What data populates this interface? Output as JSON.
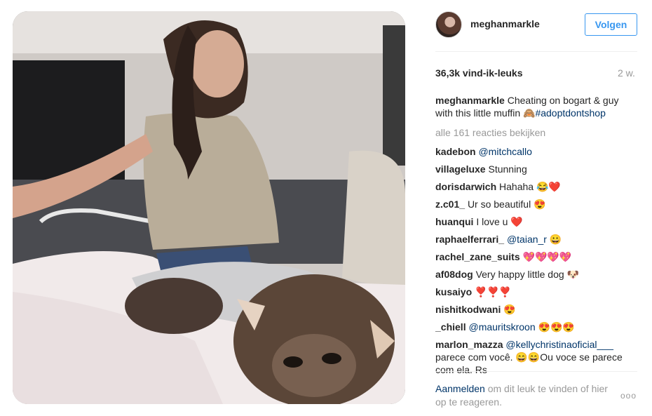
{
  "post": {
    "username": "meghanmarkle",
    "follow_label": "Volgen",
    "likes": "36,3k vind-ik-leuks",
    "time": "2 w.",
    "caption_text": "Cheating on bogart & guy with this little muffin 🙈",
    "caption_hashtag": "#adoptdontshop",
    "view_all": "alle 161 reacties bekijken",
    "login_link": "Aanmelden",
    "login_rest": " om dit leuk te vinden of hier op te reageren.",
    "more_label": "ooo"
  },
  "comments": [
    {
      "user": "kadebon",
      "mention": "@mitchcallo",
      "text": ""
    },
    {
      "user": "villageluxe",
      "mention": "",
      "text": "Stunning"
    },
    {
      "user": "dorisdarwich",
      "mention": "",
      "text": "Hahaha 😂❤️"
    },
    {
      "user": "z.c01_",
      "mention": "",
      "text": "Ur so beautiful 😍"
    },
    {
      "user": "huanqui",
      "mention": "",
      "text": "I love u ❤️"
    },
    {
      "user": "raphaelferrari_",
      "mention": "@taian_r",
      "text": " 😀"
    },
    {
      "user": "rachel_zane_suits",
      "mention": "",
      "text": "💖💖💖💖"
    },
    {
      "user": "af08dog",
      "mention": "",
      "text": "Very happy little dog 🐶"
    },
    {
      "user": "kusaiyo",
      "mention": "",
      "text": "❣️❣️❣️"
    },
    {
      "user": "nishitkodwani",
      "mention": "",
      "text": "😍"
    },
    {
      "user": "_chiell",
      "mention": "@mauritskroon",
      "text": " 😍😍😍"
    },
    {
      "user": "marlon_mazza",
      "mention": "@kellychristinaoficial___",
      "text": " parece com você. 😄😄Ou voce se parece com ela. Rs"
    }
  ]
}
